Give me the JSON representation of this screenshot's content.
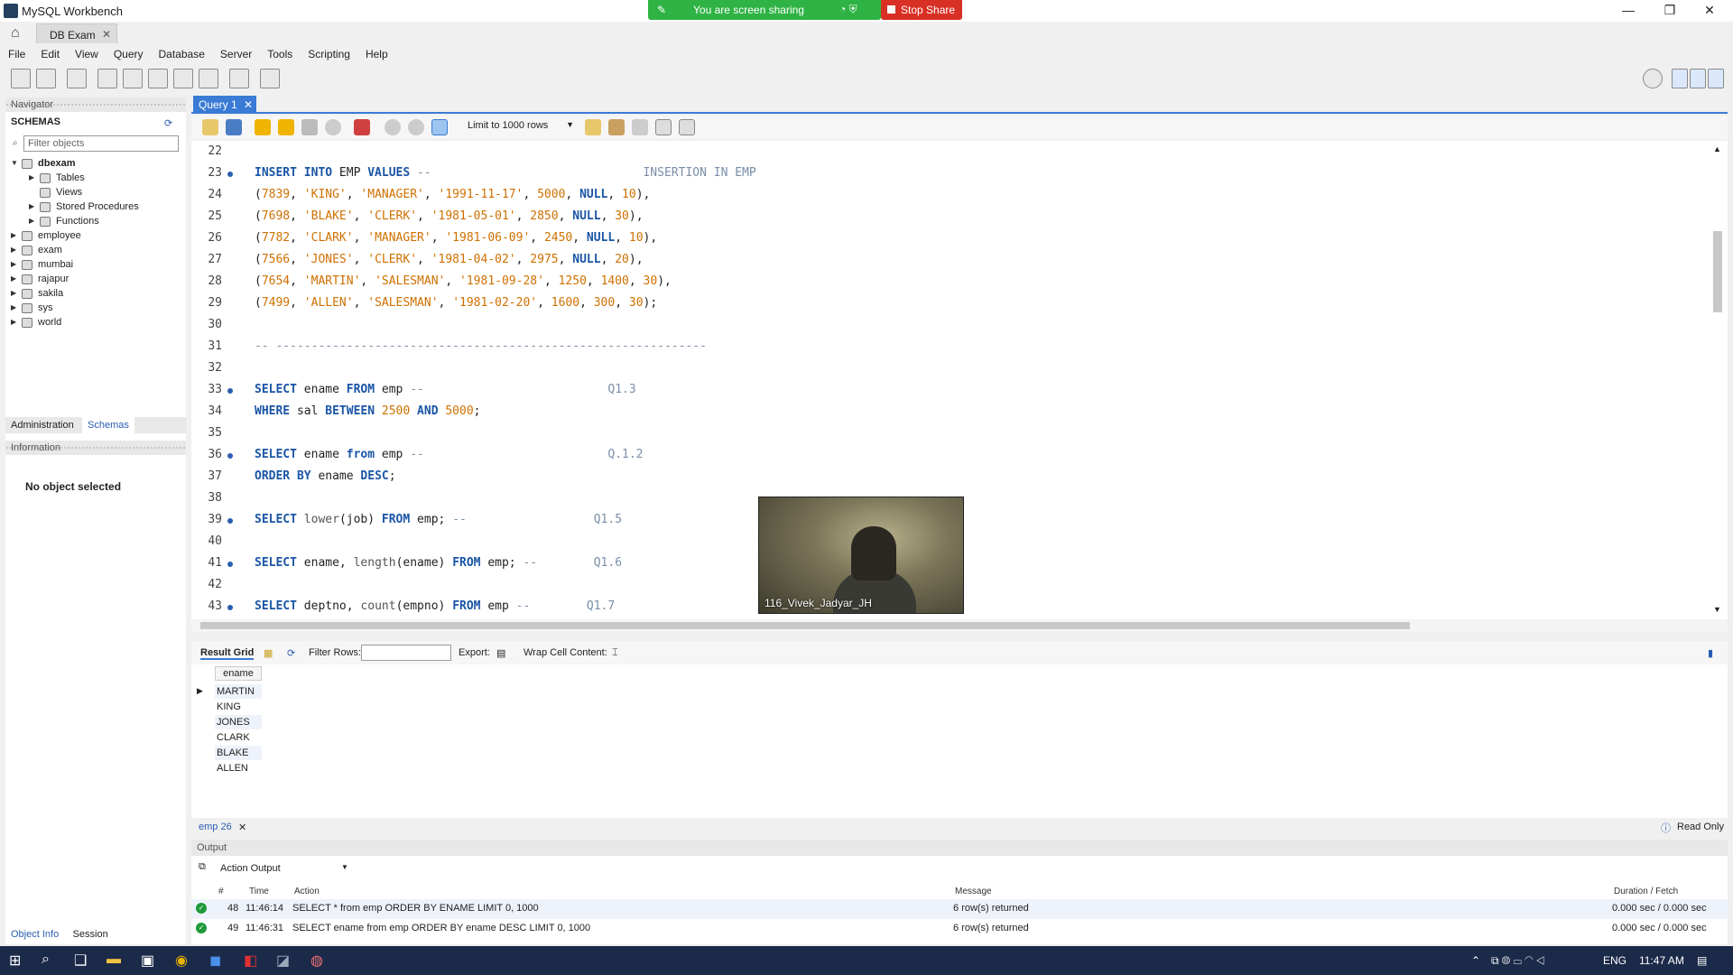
{
  "window": {
    "title": "MySQL Workbench",
    "minimize": "—",
    "restore": "❐",
    "close": "✕"
  },
  "share": {
    "text": "You are screen sharing",
    "stop": "Stop Share"
  },
  "connection_tab": {
    "label": "DB Exam",
    "close": "✕"
  },
  "menu": [
    "File",
    "Edit",
    "View",
    "Query",
    "Database",
    "Server",
    "Tools",
    "Scripting",
    "Help"
  ],
  "navigator": {
    "header": "Navigator",
    "schemas_label": "SCHEMAS",
    "filter_placeholder": "Filter objects",
    "tree": [
      {
        "label": "dbexam",
        "level": 0,
        "open": true,
        "bold": true
      },
      {
        "label": "Tables",
        "level": 1
      },
      {
        "label": "Views",
        "level": 1,
        "noarrow": true
      },
      {
        "label": "Stored Procedures",
        "level": 1
      },
      {
        "label": "Functions",
        "level": 1
      },
      {
        "label": "employee",
        "level": 0
      },
      {
        "label": "exam",
        "level": 0
      },
      {
        "label": "mumbai",
        "level": 0
      },
      {
        "label": "rajapur",
        "level": 0
      },
      {
        "label": "sakila",
        "level": 0
      },
      {
        "label": "sys",
        "level": 0
      },
      {
        "label": "world",
        "level": 0
      }
    ],
    "tab_admin": "Administration",
    "tab_schemas": "Schemas",
    "info_header": "Information",
    "no_object": "No object selected",
    "tab_object_info": "Object Info",
    "tab_session": "Session"
  },
  "query_tab": {
    "label": "Query 1",
    "close": "✕"
  },
  "limit": "Limit to 1000 rows",
  "editor_lines": [
    {
      "n": "22",
      "dot": false,
      "html": ""
    },
    {
      "n": "23",
      "dot": true,
      "html": "<span class='k'>INSERT INTO</span> EMP <span class='k'>VALUES</span> <span class='c'>--                              INSERTION IN EMP</span>"
    },
    {
      "n": "24",
      "dot": false,
      "html": "(<span class='n'>7839</span>, <span class='s'>'KING'</span>, <span class='s'>'MANAGER'</span>, <span class='s'>'1991-11-17'</span>, <span class='n'>5000</span>, <span class='k'>NULL</span>, <span class='n'>10</span>),"
    },
    {
      "n": "25",
      "dot": false,
      "html": "(<span class='n'>7698</span>, <span class='s'>'BLAKE'</span>, <span class='s'>'CLERK'</span>, <span class='s'>'1981-05-01'</span>, <span class='n'>2850</span>, <span class='k'>NULL</span>, <span class='n'>30</span>),"
    },
    {
      "n": "26",
      "dot": false,
      "html": "(<span class='n'>7782</span>, <span class='s'>'CLARK'</span>, <span class='s'>'MANAGER'</span>, <span class='s'>'1981-06-09'</span>, <span class='n'>2450</span>, <span class='k'>NULL</span>, <span class='n'>10</span>),"
    },
    {
      "n": "27",
      "dot": false,
      "html": "(<span class='n'>7566</span>, <span class='s'>'JONES'</span>, <span class='s'>'CLERK'</span>, <span class='s'>'1981-04-02'</span>, <span class='n'>2975</span>, <span class='k'>NULL</span>, <span class='n'>20</span>),"
    },
    {
      "n": "28",
      "dot": false,
      "html": "(<span class='n'>7654</span>, <span class='s'>'MARTIN'</span>, <span class='s'>'SALESMAN'</span>, <span class='s'>'1981-09-28'</span>, <span class='n'>1250</span>, <span class='n'>1400</span>, <span class='n'>30</span>),"
    },
    {
      "n": "29",
      "dot": false,
      "html": "(<span class='n'>7499</span>, <span class='s'>'ALLEN'</span>, <span class='s'>'SALESMAN'</span>, <span class='s'>'1981-02-20'</span>, <span class='n'>1600</span>, <span class='n'>300</span>, <span class='n'>30</span>);"
    },
    {
      "n": "30",
      "dot": false,
      "html": ""
    },
    {
      "n": "31",
      "dot": false,
      "html": "<span class='c'>-- -------------------------------------------------------------</span>"
    },
    {
      "n": "32",
      "dot": false,
      "html": ""
    },
    {
      "n": "33",
      "dot": true,
      "html": "<span class='k'>SELECT</span> ename <span class='k'>FROM</span> emp <span class='c'>--                          Q1.3</span>"
    },
    {
      "n": "34",
      "dot": false,
      "html": "<span class='k'>WHERE</span> sal <span class='k'>BETWEEN</span> <span class='n'>2500</span> <span class='k'>AND</span> <span class='n'>5000</span>;"
    },
    {
      "n": "35",
      "dot": false,
      "html": ""
    },
    {
      "n": "36",
      "dot": true,
      "html": "<span class='k'>SELECT</span> ename <span class='k'>from</span> emp <span class='c'>--                          Q.1.2</span>"
    },
    {
      "n": "37",
      "dot": false,
      "html": "<span class='k'>ORDER BY</span> ename <span class='k'>DESC</span>;"
    },
    {
      "n": "38",
      "dot": false,
      "html": ""
    },
    {
      "n": "39",
      "dot": true,
      "html": "<span class='k'>SELECT</span> <span class='f'>lower</span>(job) <span class='k'>FROM</span> emp; <span class='c'>--                  Q1.5</span>"
    },
    {
      "n": "40",
      "dot": false,
      "html": ""
    },
    {
      "n": "41",
      "dot": true,
      "html": "<span class='k'>SELECT</span> ename, <span class='f'>length</span>(ename) <span class='k'>FROM</span> emp; <span class='c'>--        Q1.6</span>"
    },
    {
      "n": "42",
      "dot": false,
      "html": ""
    },
    {
      "n": "43",
      "dot": true,
      "html": "<span class='k'>SELECT</span> deptno, <span class='f'>count</span>(empno) <span class='k'>FROM</span> emp <span class='c'>--        Q1.7</span>"
    }
  ],
  "video": {
    "name": "116_Vivek_Jadyar_JH"
  },
  "result_toolbar": {
    "result_grid": "Result Grid",
    "filter_rows": "Filter Rows:",
    "export": "Export:",
    "wrap": "Wrap Cell Content:"
  },
  "result": {
    "column": "ename",
    "rows": [
      "MARTIN",
      "KING",
      "JONES",
      "CLARK",
      "BLAKE",
      "ALLEN"
    ]
  },
  "result_tab": {
    "label": "emp 26",
    "close": "✕",
    "read_only": "Read Only"
  },
  "output": {
    "header": "Output",
    "selector": "Action Output",
    "columns": {
      "num": "#",
      "time": "Time",
      "action": "Action",
      "message": "Message",
      "duration": "Duration / Fetch"
    },
    "rows": [
      {
        "num": "48",
        "time": "11:46:14",
        "action": "SELECT * from emp ORDER BY ENAME LIMIT 0, 1000",
        "message": "6 row(s) returned",
        "duration": "0.000 sec / 0.000 sec"
      },
      {
        "num": "49",
        "time": "11:46:31",
        "action": "SELECT ename from emp ORDER BY ename DESC LIMIT 0, 1000",
        "message": "6 row(s) returned",
        "duration": "0.000 sec / 0.000 sec"
      }
    ]
  },
  "taskbar": {
    "lang": "ENG",
    "time": "11:47 AM"
  }
}
